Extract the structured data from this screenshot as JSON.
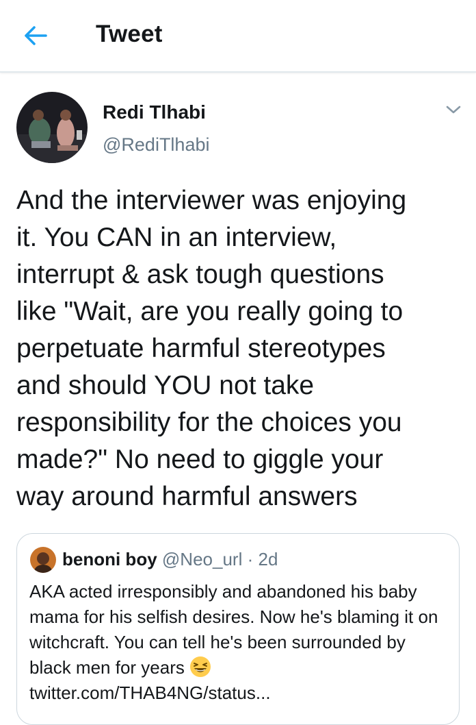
{
  "header": {
    "title": "Tweet",
    "back_icon": "arrow-left-icon"
  },
  "colors": {
    "accent": "#1da1f2",
    "text_primary": "#14171a",
    "text_secondary": "#657786",
    "border": "#ccd6dd"
  },
  "tweet": {
    "author_name": "Redi Tlhabi",
    "author_handle": "@RediTlhabi",
    "menu_icon": "chevron-down-icon",
    "text": "And the interviewer was enjoying\nit. You CAN in an interview,\ninterrupt & ask tough questions\nlike \"Wait, are you really going to\nperpetuate harmful stereotypes\nand should YOU not take\nresponsibility for the choices you\nmade?\" No need to giggle your\nway around harmful answers"
  },
  "quoted_tweet": {
    "author_name": "benoni boy",
    "author_handle": "@Neo_url",
    "separator": "·",
    "time": "2d",
    "text": "AKA acted irresponsibly and abandoned his baby mama for his selfish desires. Now he's blaming it on witchcraft. You can tell he's been surrounded by black men for years",
    "emoji": "grinning-squinting-face-emoji",
    "link": "twitter.com/THAB4NG/status..."
  }
}
